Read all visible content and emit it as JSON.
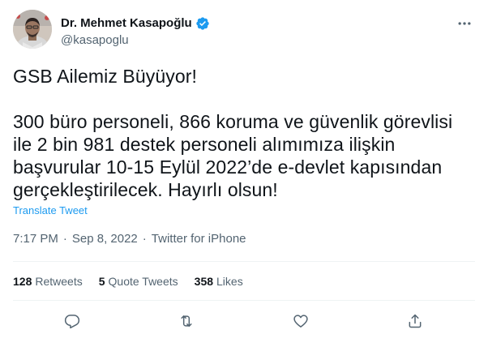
{
  "author": {
    "display_name": "Dr. Mehmet Kasapoğlu",
    "handle": "@kasapoglu",
    "verified_icon": "verified-badge-icon",
    "avatar_icon": "profile-avatar"
  },
  "tweet": {
    "headline": "GSB Ailemiz Büyüyor!",
    "body": "300 büro personeli, 866 koruma ve güvenlik görevlisi ile 2 bin 981 destek personeli alımımıza ilişkin başvurular 10-15 Eylül 2022’de e-devlet kapısından gerçekleştirilecek. Hayırlı olsun!",
    "translate_label": "Translate Tweet",
    "time": "7:17 PM",
    "date": "Sep 8, 2022",
    "source": "Twitter for iPhone",
    "separator": "·"
  },
  "stats": {
    "retweets_count": "128",
    "retweets_label": "Retweets",
    "quotes_count": "5",
    "quotes_label": "Quote Tweets",
    "likes_count": "358",
    "likes_label": "Likes"
  },
  "actions": [
    "reply-icon",
    "retweet-icon",
    "like-icon",
    "share-icon"
  ],
  "colors": {
    "link": "#1d9bf0",
    "verified": "#1d9bf0",
    "secondary_text": "#536471",
    "primary_text": "#0f1419",
    "divider": "#eff3f4"
  }
}
